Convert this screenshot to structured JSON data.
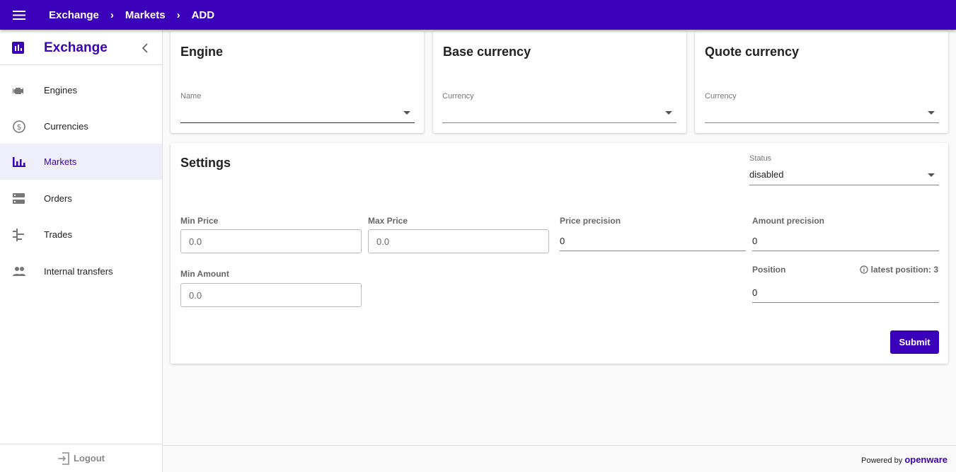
{
  "breadcrumb": [
    "Exchange",
    "Markets",
    "ADD"
  ],
  "sidebar": {
    "title": "Exchange",
    "items": [
      {
        "label": "Engines",
        "icon": "engine-icon"
      },
      {
        "label": "Currencies",
        "icon": "dollar-icon"
      },
      {
        "label": "Markets",
        "icon": "bar-chart-icon",
        "active": true
      },
      {
        "label": "Orders",
        "icon": "storage-icon"
      },
      {
        "label": "Trades",
        "icon": "trades-icon"
      },
      {
        "label": "Internal transfers",
        "icon": "people-icon"
      }
    ],
    "logout": "Logout"
  },
  "engine_card": {
    "title": "Engine",
    "label": "Name",
    "value": ""
  },
  "base_card": {
    "title": "Base currency",
    "label": "Currency",
    "value": ""
  },
  "quote_card": {
    "title": "Quote currency",
    "label": "Currency",
    "value": ""
  },
  "settings": {
    "title": "Settings",
    "status_label": "Status",
    "status_value": "disabled",
    "min_price_label": "Min Price",
    "min_price_placeholder": "0.0",
    "max_price_label": "Max Price",
    "max_price_placeholder": "0.0",
    "price_precision_label": "Price precision",
    "price_precision_value": "0",
    "amount_precision_label": "Amount precision",
    "amount_precision_value": "0",
    "min_amount_label": "Min Amount",
    "min_amount_placeholder": "0.0",
    "position_label": "Position",
    "latest_position": "latest position: 3",
    "position_value": "0",
    "submit_label": "Submit"
  },
  "footer": {
    "powered": "Powered by",
    "brand": "openware"
  },
  "colors": {
    "primary": "#3b00b9",
    "active_bg": "#efeefb"
  }
}
